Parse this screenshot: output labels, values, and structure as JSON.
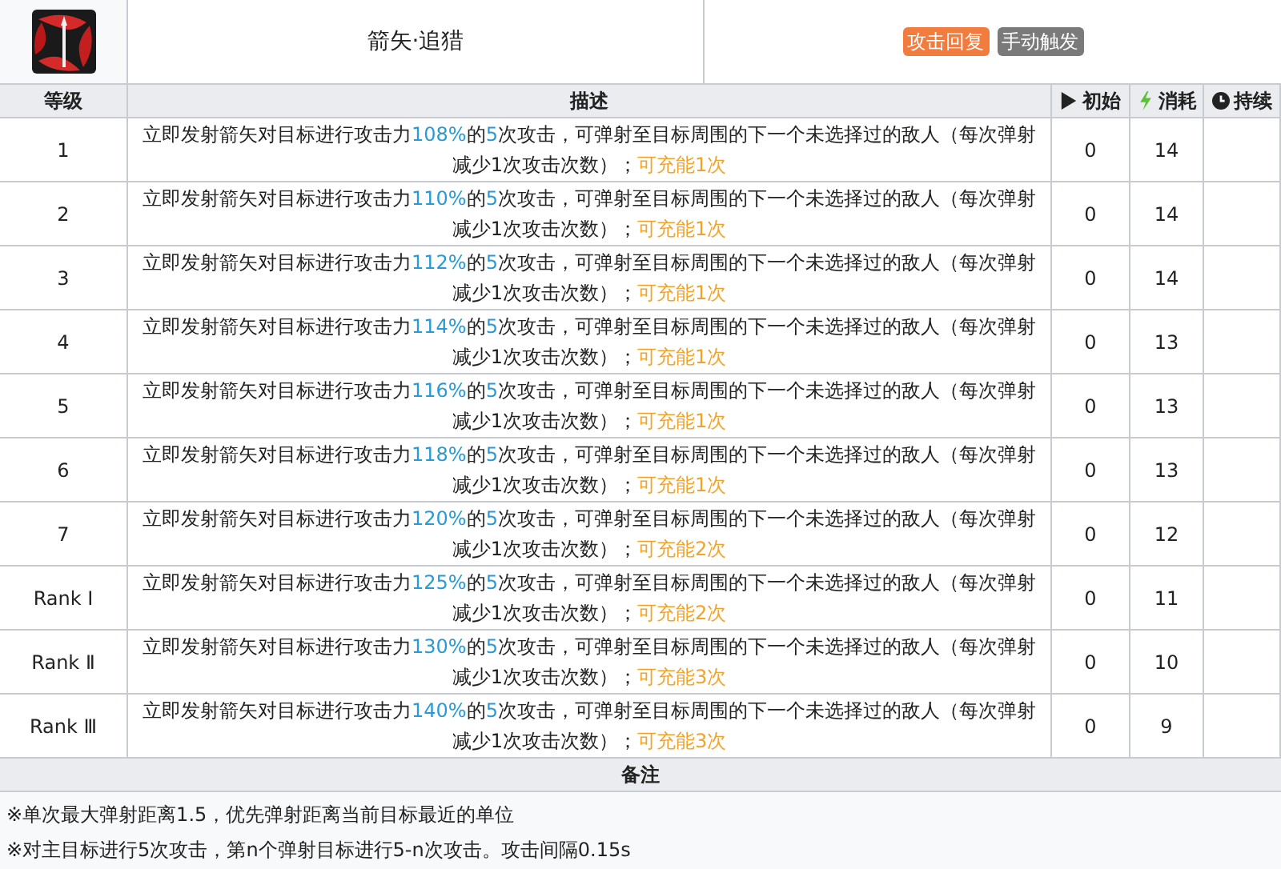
{
  "skill": {
    "name": "箭矢·追猎",
    "tags": [
      {
        "label": "攻击回复",
        "color": "#f27c3e"
      },
      {
        "label": "手动触发",
        "color": "#7a7a7a"
      }
    ]
  },
  "columns": [
    {
      "label": "等级",
      "kind": "text"
    },
    {
      "label": "描述",
      "kind": "text"
    },
    {
      "label": "初始",
      "kind": "play"
    },
    {
      "label": "消耗",
      "kind": "bolt"
    },
    {
      "label": "持续",
      "kind": "clock"
    }
  ],
  "rows": [
    {
      "level": "1",
      "description": [
        {
          "kind": "plain",
          "text": "立即发射箭矢对目标进行攻击力"
        },
        {
          "kind": "value",
          "text": "108%"
        },
        {
          "kind": "plain",
          "text": "的"
        },
        {
          "kind": "value",
          "text": "5"
        },
        {
          "kind": "plain",
          "text": "次攻击，可弹射至目标周围的下一个未选择过的敌人（每次弹射减少1次攻击次数）；"
        },
        {
          "kind": "charge",
          "text": "可充能1次"
        }
      ],
      "initial": "0",
      "cost": "14"
    },
    {
      "level": "2",
      "description": [
        {
          "kind": "plain",
          "text": "立即发射箭矢对目标进行攻击力"
        },
        {
          "kind": "value",
          "text": "110%"
        },
        {
          "kind": "plain",
          "text": "的"
        },
        {
          "kind": "value",
          "text": "5"
        },
        {
          "kind": "plain",
          "text": "次攻击，可弹射至目标周围的下一个未选择过的敌人（每次弹射减少1次攻击次数）；"
        },
        {
          "kind": "charge",
          "text": "可充能1次"
        }
      ],
      "initial": "0",
      "cost": "14"
    },
    {
      "level": "3",
      "description": [
        {
          "kind": "plain",
          "text": "立即发射箭矢对目标进行攻击力"
        },
        {
          "kind": "value",
          "text": "112%"
        },
        {
          "kind": "plain",
          "text": "的"
        },
        {
          "kind": "value",
          "text": "5"
        },
        {
          "kind": "plain",
          "text": "次攻击，可弹射至目标周围的下一个未选择过的敌人（每次弹射减少1次攻击次数）；"
        },
        {
          "kind": "charge",
          "text": "可充能1次"
        }
      ],
      "initial": "0",
      "cost": "14"
    },
    {
      "level": "4",
      "description": [
        {
          "kind": "plain",
          "text": "立即发射箭矢对目标进行攻击力"
        },
        {
          "kind": "value",
          "text": "114%"
        },
        {
          "kind": "plain",
          "text": "的"
        },
        {
          "kind": "value",
          "text": "5"
        },
        {
          "kind": "plain",
          "text": "次攻击，可弹射至目标周围的下一个未选择过的敌人（每次弹射减少1次攻击次数）；"
        },
        {
          "kind": "charge",
          "text": "可充能1次"
        }
      ],
      "initial": "0",
      "cost": "13"
    },
    {
      "level": "5",
      "description": [
        {
          "kind": "plain",
          "text": "立即发射箭矢对目标进行攻击力"
        },
        {
          "kind": "value",
          "text": "116%"
        },
        {
          "kind": "plain",
          "text": "的"
        },
        {
          "kind": "value",
          "text": "5"
        },
        {
          "kind": "plain",
          "text": "次攻击，可弹射至目标周围的下一个未选择过的敌人（每次弹射减少1次攻击次数）；"
        },
        {
          "kind": "charge",
          "text": "可充能1次"
        }
      ],
      "initial": "0",
      "cost": "13"
    },
    {
      "level": "6",
      "description": [
        {
          "kind": "plain",
          "text": "立即发射箭矢对目标进行攻击力"
        },
        {
          "kind": "value",
          "text": "118%"
        },
        {
          "kind": "plain",
          "text": "的"
        },
        {
          "kind": "value",
          "text": "5"
        },
        {
          "kind": "plain",
          "text": "次攻击，可弹射至目标周围的下一个未选择过的敌人（每次弹射减少1次攻击次数）；"
        },
        {
          "kind": "charge",
          "text": "可充能1次"
        }
      ],
      "initial": "0",
      "cost": "13"
    },
    {
      "level": "7",
      "description": [
        {
          "kind": "plain",
          "text": "立即发射箭矢对目标进行攻击力"
        },
        {
          "kind": "value",
          "text": "120%"
        },
        {
          "kind": "plain",
          "text": "的"
        },
        {
          "kind": "value",
          "text": "5"
        },
        {
          "kind": "plain",
          "text": "次攻击，可弹射至目标周围的下一个未选择过的敌人（每次弹射减少1次攻击次数）；"
        },
        {
          "kind": "charge",
          "text": "可充能2次"
        }
      ],
      "initial": "0",
      "cost": "12"
    },
    {
      "level": "Rank Ⅰ",
      "description": [
        {
          "kind": "plain",
          "text": "立即发射箭矢对目标进行攻击力"
        },
        {
          "kind": "value",
          "text": "125%"
        },
        {
          "kind": "plain",
          "text": "的"
        },
        {
          "kind": "value",
          "text": "5"
        },
        {
          "kind": "plain",
          "text": "次攻击，可弹射至目标周围的下一个未选择过的敌人（每次弹射减少1次攻击次数）；"
        },
        {
          "kind": "charge",
          "text": "可充能2次"
        }
      ],
      "initial": "0",
      "cost": "11"
    },
    {
      "level": "Rank Ⅱ",
      "description": [
        {
          "kind": "plain",
          "text": "立即发射箭矢对目标进行攻击力"
        },
        {
          "kind": "value",
          "text": "130%"
        },
        {
          "kind": "plain",
          "text": "的"
        },
        {
          "kind": "value",
          "text": "5"
        },
        {
          "kind": "plain",
          "text": "次攻击，可弹射至目标周围的下一个未选择过的敌人（每次弹射减少1次攻击次数）；"
        },
        {
          "kind": "charge",
          "text": "可充能3次"
        }
      ],
      "initial": "0",
      "cost": "10"
    },
    {
      "level": "Rank Ⅲ",
      "description": [
        {
          "kind": "plain",
          "text": "立即发射箭矢对目标进行攻击力"
        },
        {
          "kind": "value",
          "text": "140%"
        },
        {
          "kind": "plain",
          "text": "的"
        },
        {
          "kind": "value",
          "text": "5"
        },
        {
          "kind": "plain",
          "text": "次攻击，可弹射至目标周围的下一个未选择过的敌人（每次弹射减少1次攻击次数）；"
        },
        {
          "kind": "charge",
          "text": "可充能3次"
        }
      ],
      "initial": "0",
      "cost": "9"
    }
  ],
  "notes": {
    "title": "备注",
    "lines": [
      "※单次最大弹射距离1.5，优先弹射距离当前目标最近的单位",
      "※对主目标进行5次攻击，第n个弹射目标进行5-n次攻击。攻击间隔0.15s"
    ]
  }
}
